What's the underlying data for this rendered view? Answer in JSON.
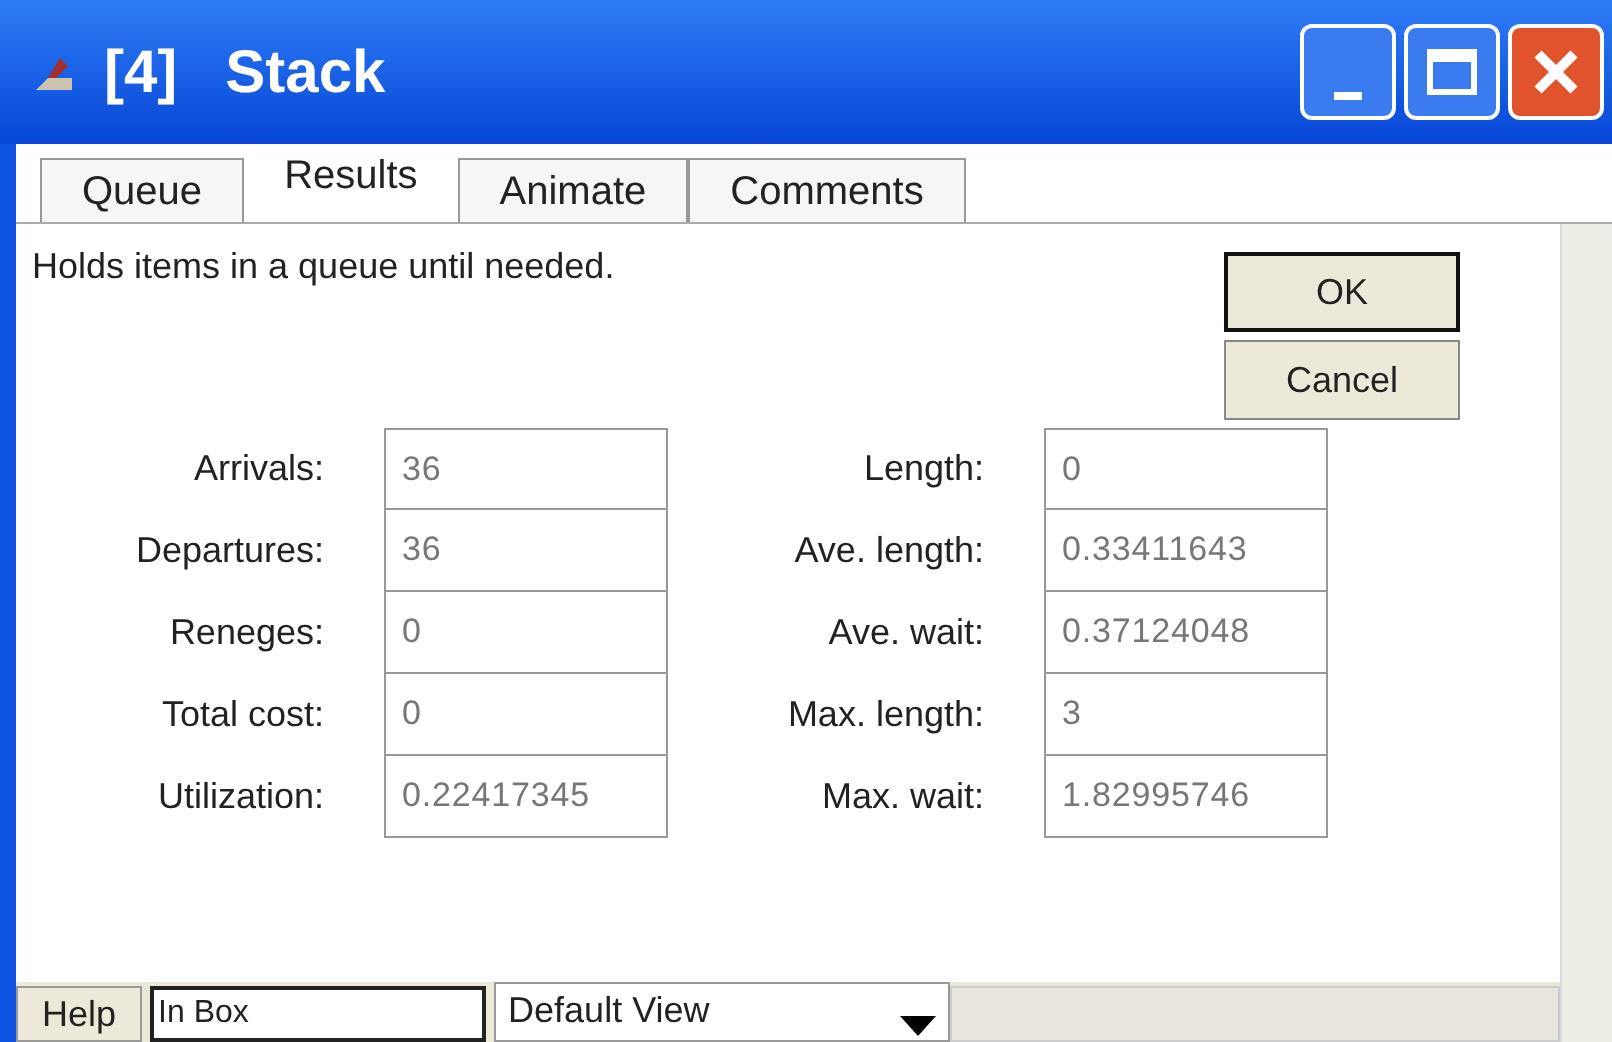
{
  "window": {
    "badge": "[4]",
    "title": "Stack"
  },
  "tabs": [
    {
      "label": "Queue",
      "selected": false
    },
    {
      "label": "Results",
      "selected": true
    },
    {
      "label": "Animate",
      "selected": false
    },
    {
      "label": "Comments",
      "selected": false
    }
  ],
  "description": "Holds items in a queue until needed.",
  "buttons": [
    "OK",
    "Cancel"
  ],
  "stats_left": [
    {
      "label": "Arrivals:",
      "value": "36"
    },
    {
      "label": "Departures:",
      "value": "36"
    },
    {
      "label": "Reneges:",
      "value": "0"
    },
    {
      "label": "Total cost:",
      "value": "0"
    },
    {
      "label": "Utilization:",
      "value": "0.22417345"
    }
  ],
  "stats_right": [
    {
      "label": "Length:",
      "value": "0"
    },
    {
      "label": "Ave. length:",
      "value": "0.33411643"
    },
    {
      "label": "Ave. wait:",
      "value": "0.37124048"
    },
    {
      "label": "Max. length:",
      "value": "3"
    },
    {
      "label": "Max. wait:",
      "value": "1.82995746"
    }
  ],
  "bottom_bar": {
    "help": "Help",
    "input_value": "In Box",
    "view": "Default View"
  }
}
